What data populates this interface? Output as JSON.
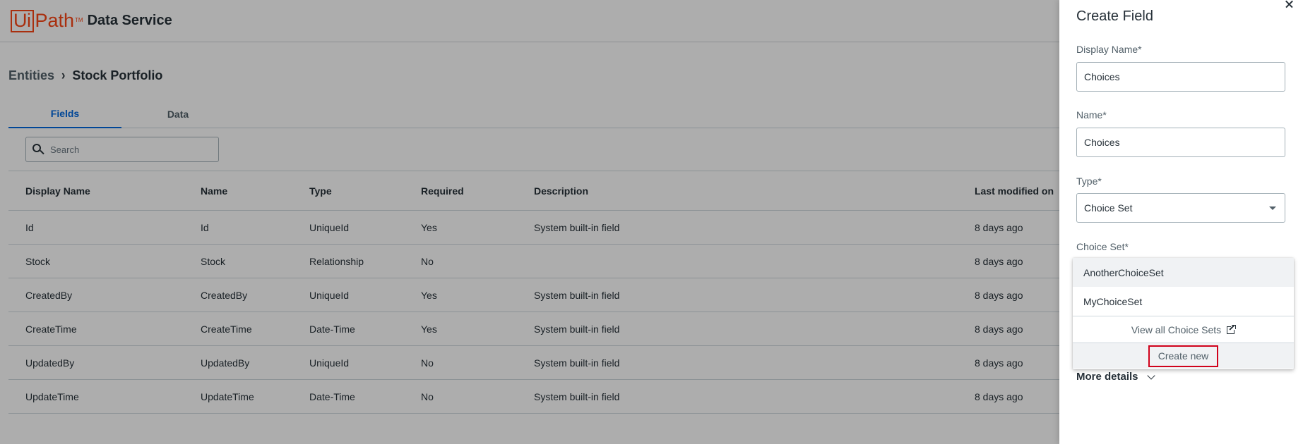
{
  "header": {
    "logo_ui": "Ui",
    "logo_path": "Path",
    "logo_tm": "TM",
    "product": "Data Service"
  },
  "breadcrumb": {
    "root": "Entities",
    "separator": "›",
    "current": "Stock Portfolio"
  },
  "tabs": [
    {
      "label": "Fields",
      "active": true
    },
    {
      "label": "Data",
      "active": false
    }
  ],
  "search": {
    "placeholder": "Search",
    "value": ""
  },
  "table": {
    "columns": [
      "Display Name",
      "Name",
      "Type",
      "Required",
      "Description",
      "Last modified on"
    ],
    "rows": [
      {
        "display_name": "Id",
        "name": "Id",
        "type": "UniqueId",
        "required": "Yes",
        "description": "System built-in field",
        "modified": "8 days ago"
      },
      {
        "display_name": "Stock",
        "name": "Stock",
        "type": "Relationship",
        "required": "No",
        "description": "",
        "modified": "8 days ago"
      },
      {
        "display_name": "CreatedBy",
        "name": "CreatedBy",
        "type": "UniqueId",
        "required": "Yes",
        "description": "System built-in field",
        "modified": "8 days ago"
      },
      {
        "display_name": "CreateTime",
        "name": "CreateTime",
        "type": "Date-Time",
        "required": "Yes",
        "description": "System built-in field",
        "modified": "8 days ago"
      },
      {
        "display_name": "UpdatedBy",
        "name": "UpdatedBy",
        "type": "UniqueId",
        "required": "No",
        "description": "System built-in field",
        "modified": "8 days ago"
      },
      {
        "display_name": "UpdateTime",
        "name": "UpdateTime",
        "type": "Date-Time",
        "required": "No",
        "description": "System built-in field",
        "modified": "8 days ago"
      }
    ]
  },
  "panel": {
    "title": "Create Field",
    "display_name": {
      "label": "Display Name*",
      "value": "Choices"
    },
    "name": {
      "label": "Name*",
      "value": "Choices"
    },
    "type": {
      "label": "Type*",
      "value": "Choice Set"
    },
    "choice_set": {
      "label": "Choice Set*",
      "options": [
        "AnotherChoiceSet",
        "MyChoiceSet"
      ],
      "view_all": "View all Choice Sets",
      "create_new": "Create new"
    },
    "more_details": "More details"
  },
  "colors": {
    "brand": "#fa4616",
    "accent": "#0067df",
    "highlight_border": "#d0021b"
  }
}
